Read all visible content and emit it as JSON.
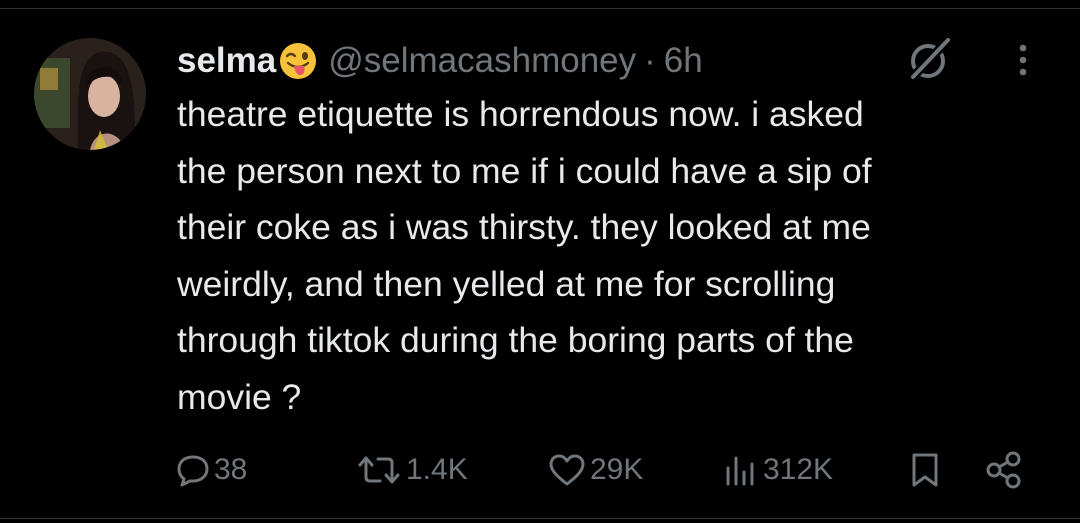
{
  "tweet": {
    "display_name": "selma",
    "handle": "@selmacashmoney",
    "separator": "·",
    "time": "6h",
    "text_lines": [
      "theatre etiquette is horrendous now. i asked",
      "the person next to me if i could have a sip of",
      "their coke as i was thirsty. they looked at me",
      "weirdly, and then yelled at me for scrolling",
      "through tiktok during the boring parts of the",
      "movie ?"
    ]
  },
  "actions": {
    "replies": "38",
    "reposts": "1.4K",
    "likes": "29K",
    "views": "312K"
  },
  "icons": {
    "emoji": "winking-face-with-tongue-emoji",
    "grok": "grok-icon",
    "more": "more-dots-icon",
    "reply": "reply-icon",
    "repost": "repost-icon",
    "like": "heart-icon",
    "views": "views-chart-icon",
    "bookmark": "bookmark-icon",
    "share": "share-icon"
  },
  "colors": {
    "background": "#000000",
    "text": "#e7e9ea",
    "muted": "#71767b",
    "emoji_yellow": "#f7c23a",
    "tongue": "#e8526a"
  }
}
